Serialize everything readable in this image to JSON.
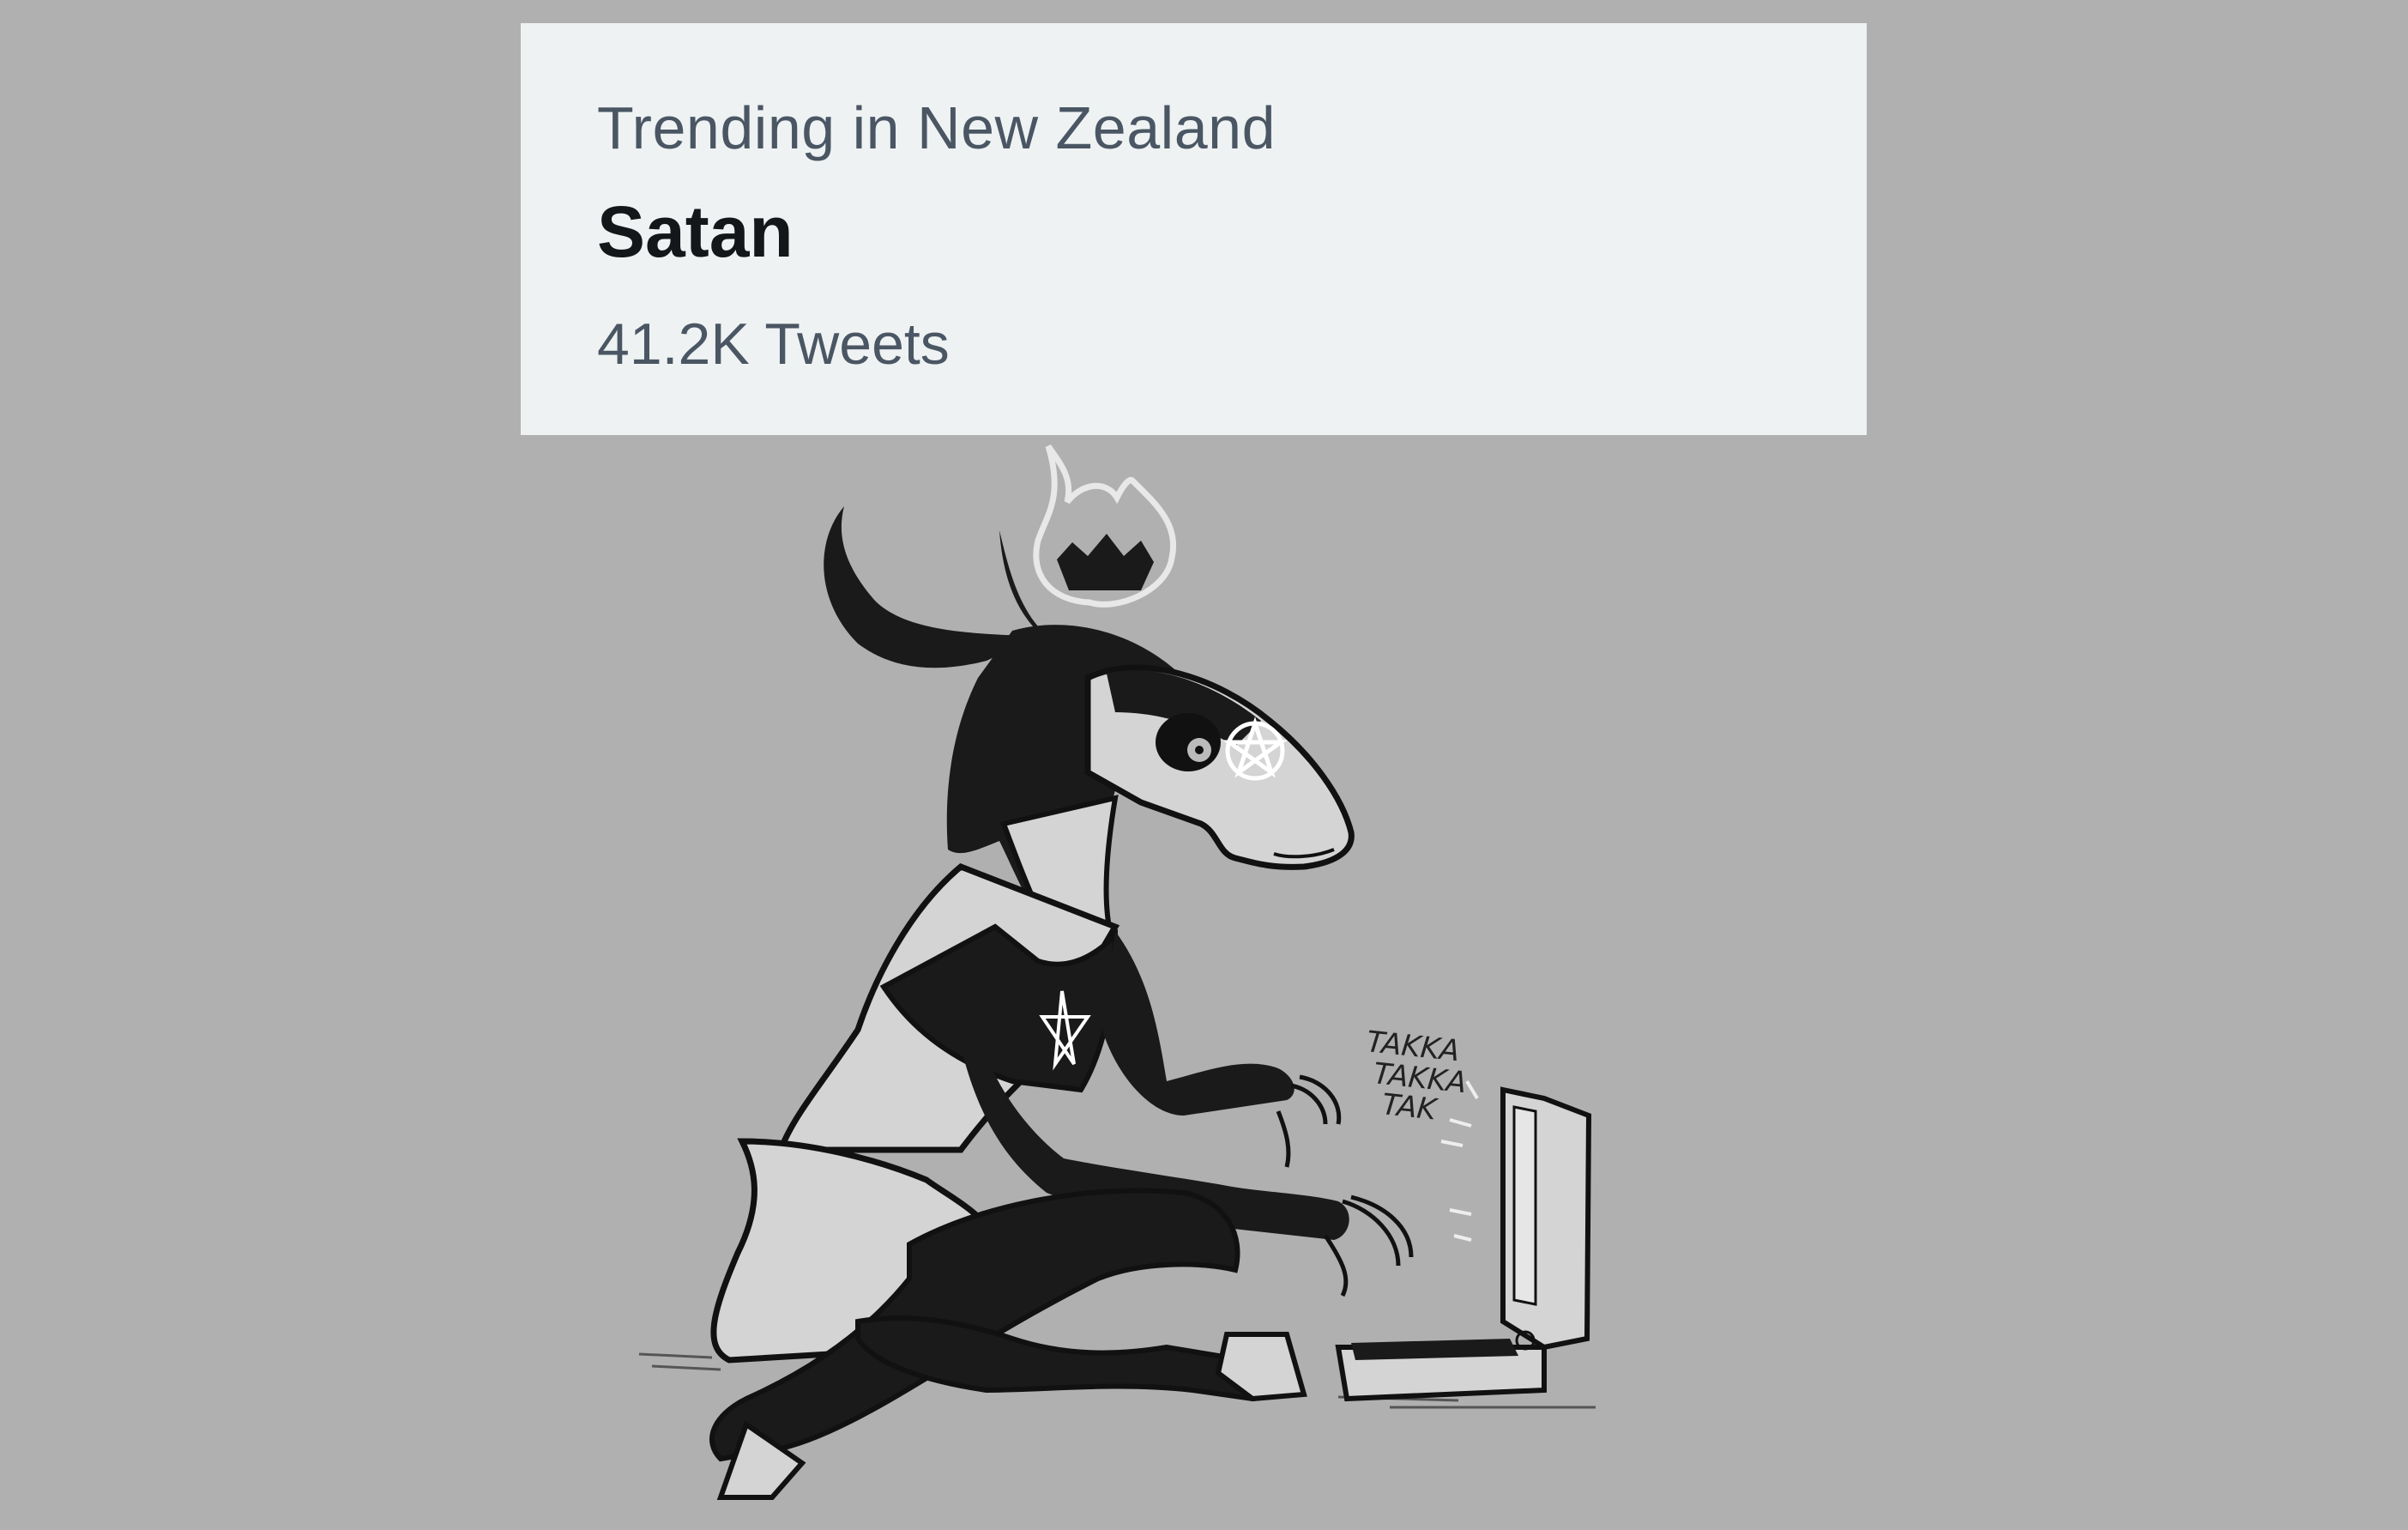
{
  "trend": {
    "context": "Trending in New Zealand",
    "topic": "Satan",
    "count": "41.2K Tweets"
  },
  "illustration": {
    "sound_effect_lines": [
      "TAKKA",
      "TAKKA",
      "TAK"
    ]
  },
  "colors": {
    "background": "#b0b0b0",
    "card": "#eef2f3",
    "topic_text": "#14171a",
    "secondary_text": "#4a5663"
  }
}
